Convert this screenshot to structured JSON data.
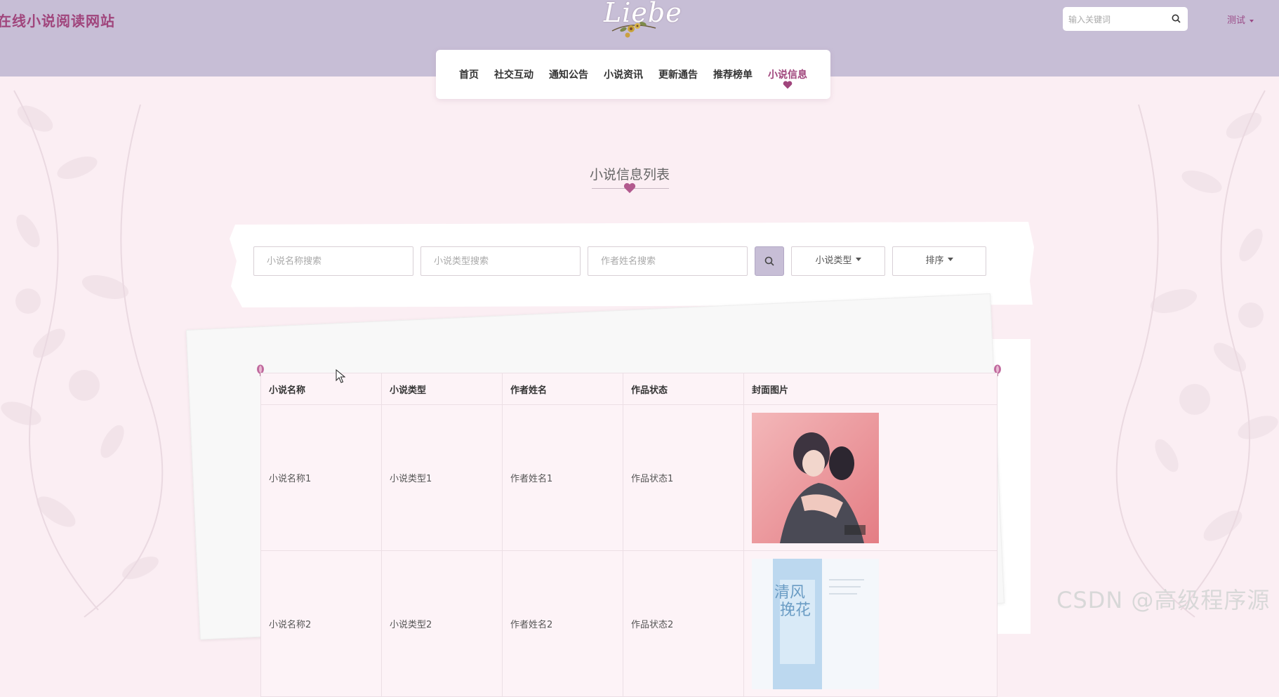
{
  "header": {
    "site_title": "在线小说阅读网站",
    "logo_text": "Liebe",
    "search_placeholder": "输入关键词",
    "user_label": "测试"
  },
  "nav": {
    "items": [
      {
        "label": "首页"
      },
      {
        "label": "社交互动"
      },
      {
        "label": "通知公告"
      },
      {
        "label": "小说资讯"
      },
      {
        "label": "更新通告"
      },
      {
        "label": "推荐榜单"
      },
      {
        "label": "小说信息",
        "active": true
      }
    ]
  },
  "section": {
    "title": "小说信息列表"
  },
  "filters": {
    "name_placeholder": "小说名称搜索",
    "type_placeholder": "小说类型搜索",
    "author_placeholder": "作者姓名搜索",
    "type_dropdown": "小说类型",
    "sort_dropdown": "排序"
  },
  "table": {
    "headers": [
      "小说名称",
      "小说类型",
      "作者姓名",
      "作品状态",
      "封面图片"
    ],
    "rows": [
      [
        "小说名称1",
        "小说类型1",
        "作者姓名1",
        "作品状态1"
      ],
      [
        "小说名称2",
        "小说类型2",
        "作者姓名2",
        "作品状态2"
      ]
    ]
  },
  "watermark": "CSDN @高级程序源",
  "colors": {
    "header_bg": "#c7bed6",
    "accent": "#a0457c",
    "page_bg": "#fbeef3"
  }
}
